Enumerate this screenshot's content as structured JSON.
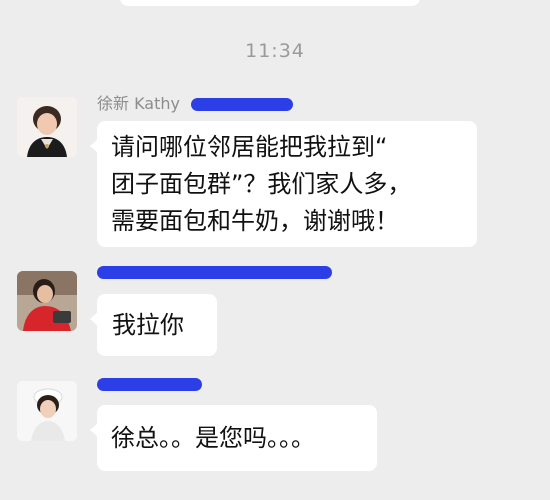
{
  "timestamp": "11:34",
  "messages": [
    {
      "sender": "徐新 Kathy",
      "text": "请问哪位邻居能把我拉到“\n团子面包群”？我们家人多，\n需要面包和牛奶，谢谢哦！",
      "avatar_icon": "profile-photo-woman-red-top"
    },
    {
      "sender": "",
      "text": "我拉你",
      "avatar_icon": "profile-photo-woman-red-sweater"
    },
    {
      "sender": "",
      "text": "徐总。。是您吗。。。",
      "avatar_icon": "profile-photo-woman-white-cap"
    }
  ],
  "colors": {
    "background": "#ededed",
    "bubble": "#ffffff",
    "redaction_marker": "#2c3fe6",
    "sender_name": "#8c8c8c",
    "timestamp": "#9a9a9a"
  }
}
